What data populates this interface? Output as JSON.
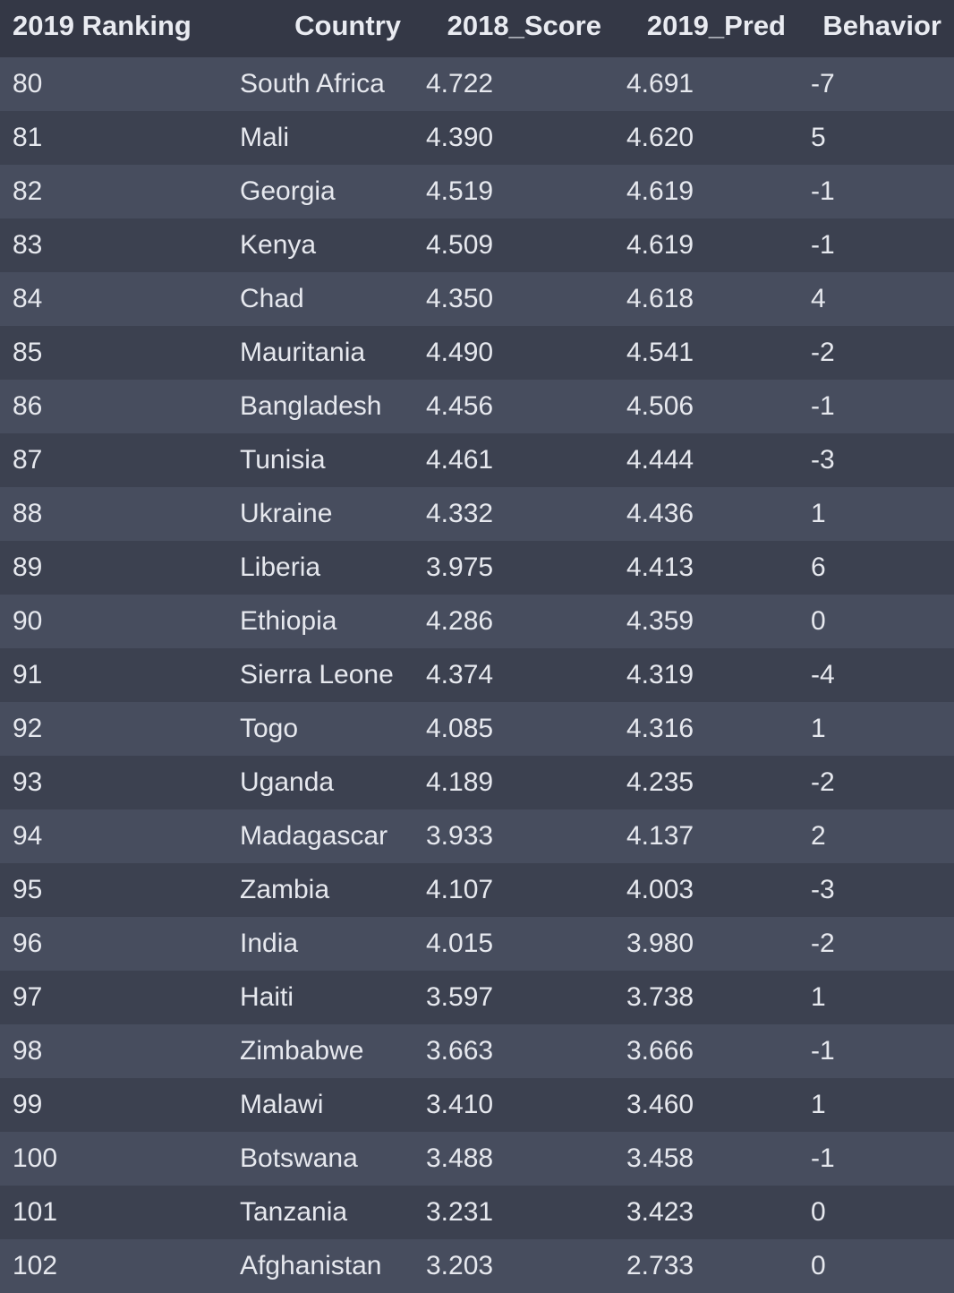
{
  "table": {
    "headers": [
      "2019 Ranking",
      "Country",
      "2018_Score",
      "2019_Pred",
      "Behavior"
    ],
    "rows": [
      [
        "80",
        "South Africa",
        "4.722",
        "4.691",
        "-7"
      ],
      [
        "81",
        "Mali",
        "4.390",
        "4.620",
        "5"
      ],
      [
        "82",
        "Georgia",
        "4.519",
        "4.619",
        "-1"
      ],
      [
        "83",
        "Kenya",
        "4.509",
        "4.619",
        "-1"
      ],
      [
        "84",
        "Chad",
        "4.350",
        "4.618",
        "4"
      ],
      [
        "85",
        "Mauritania",
        "4.490",
        "4.541",
        "-2"
      ],
      [
        "86",
        "Bangladesh",
        "4.456",
        "4.506",
        "-1"
      ],
      [
        "87",
        "Tunisia",
        "4.461",
        "4.444",
        "-3"
      ],
      [
        "88",
        "Ukraine",
        "4.332",
        "4.436",
        "1"
      ],
      [
        "89",
        "Liberia",
        "3.975",
        "4.413",
        "6"
      ],
      [
        "90",
        "Ethiopia",
        "4.286",
        "4.359",
        "0"
      ],
      [
        "91",
        "Sierra Leone",
        "4.374",
        "4.319",
        "-4"
      ],
      [
        "92",
        "Togo",
        "4.085",
        "4.316",
        "1"
      ],
      [
        "93",
        "Uganda",
        "4.189",
        "4.235",
        "-2"
      ],
      [
        "94",
        "Madagascar",
        "3.933",
        "4.137",
        "2"
      ],
      [
        "95",
        "Zambia",
        "4.107",
        "4.003",
        "-3"
      ],
      [
        "96",
        "India",
        "4.015",
        "3.980",
        "-2"
      ],
      [
        "97",
        "Haiti",
        "3.597",
        "3.738",
        "1"
      ],
      [
        "98",
        "Zimbabwe",
        "3.663",
        "3.666",
        "-1"
      ],
      [
        "99",
        "Malawi",
        "3.410",
        "3.460",
        "1"
      ],
      [
        "100",
        "Botswana",
        "3.488",
        "3.458",
        "-1"
      ],
      [
        "101",
        "Tanzania",
        "3.231",
        "3.423",
        "0"
      ],
      [
        "102",
        "Afghanistan",
        "3.203",
        "2.733",
        "0"
      ]
    ]
  },
  "colors": {
    "header_bg": "#343846",
    "row_odd_bg": "#474d5e",
    "row_even_bg": "#3c4150",
    "text": "#e6e8ee"
  }
}
